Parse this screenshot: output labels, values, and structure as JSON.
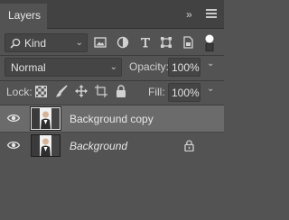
{
  "panel": {
    "title": "Layers",
    "collapse_glyph": "»",
    "menu_icon": "hamburger-menu-icon"
  },
  "filter": {
    "kind_label": "Kind",
    "search_icon": "search-icon",
    "chevron": "⌄",
    "filter_icons": [
      "pixel-layer-filter-icon",
      "adjustment-layer-filter-icon",
      "type-layer-filter-icon",
      "shape-layer-filter-icon",
      "smart-object-filter-icon",
      "filter-toggle-icon"
    ]
  },
  "blending": {
    "mode": "Normal",
    "opacity_label": "Opacity:",
    "opacity_value": "100%"
  },
  "locks": {
    "label": "Lock:",
    "fill_label": "Fill:",
    "fill_value": "100%",
    "lock_icons": [
      "lock-transparent-pixels-icon",
      "lock-image-pixels-icon",
      "lock-position-icon",
      "lock-artboard-icon",
      "lock-all-icon"
    ]
  },
  "layers": [
    {
      "name": "Background copy",
      "visible": true,
      "selected": true,
      "locked": false
    },
    {
      "name": "Background",
      "visible": true,
      "selected": false,
      "locked": true
    }
  ],
  "colors": {
    "panel_bg": "#535353",
    "selected_row": "#6b6b6b",
    "field_bg": "#454545",
    "tab_bar": "#424242"
  }
}
